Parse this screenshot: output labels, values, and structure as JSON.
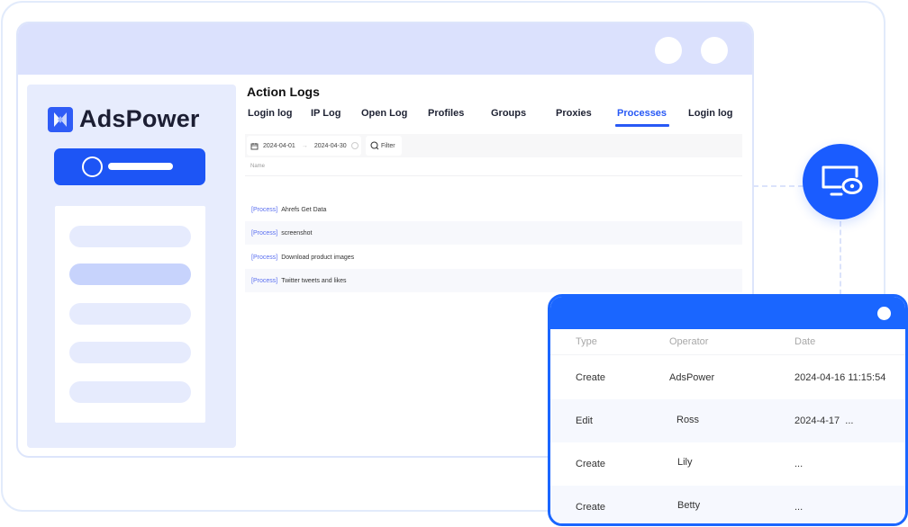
{
  "window": {
    "controls": [
      "window-dot",
      "window-dot"
    ]
  },
  "sidebar": {
    "brand": "AdsPower",
    "accent_color": "#1d55f5",
    "menu_items": [
      {
        "state": "default"
      },
      {
        "state": "active"
      },
      {
        "state": "default"
      },
      {
        "state": "default"
      },
      {
        "state": "default"
      }
    ]
  },
  "main": {
    "title": "Action Logs",
    "tabs": [
      {
        "label": "Login log",
        "active": false
      },
      {
        "label": "IP Log",
        "active": false
      },
      {
        "label": "Open Log",
        "active": false
      },
      {
        "label": "Profiles",
        "active": false
      },
      {
        "label": "Groups",
        "active": false
      },
      {
        "label": "Proxies",
        "active": false
      },
      {
        "label": "Processes",
        "active": true
      },
      {
        "label": "Login log",
        "active": false
      }
    ],
    "filter": {
      "date_start": "2024-04-01",
      "date_sep": "→",
      "date_end": "2024-04-30",
      "filter_label": "Filter"
    },
    "table": {
      "column": "Name",
      "rows": [
        {
          "tag": "[Process]",
          "name": "Ahrefs Get Data"
        },
        {
          "tag": "[Process]",
          "name": "screenshot"
        },
        {
          "tag": "[Process]",
          "name": "Download product images"
        },
        {
          "tag": "[Process]",
          "name": "Twitter tweets and likes"
        }
      ]
    }
  },
  "popup": {
    "columns": {
      "type": "Type",
      "operator": "Operator",
      "date": "Date"
    },
    "rows": [
      {
        "type": "Create",
        "operator": "AdsPower",
        "date": "2024-04-16 11:15:54"
      },
      {
        "type": "Edit",
        "operator": "Ross",
        "date": "2024-4-17  ..."
      },
      {
        "type": "Create",
        "operator": "Lily",
        "date": "..."
      },
      {
        "type": "Create",
        "operator": "Betty",
        "date": "..."
      }
    ]
  },
  "icons": {
    "monitor": "monitor-eye-icon",
    "calendar": "calendar-icon",
    "search": "search-icon",
    "clear": "clear-icon"
  }
}
